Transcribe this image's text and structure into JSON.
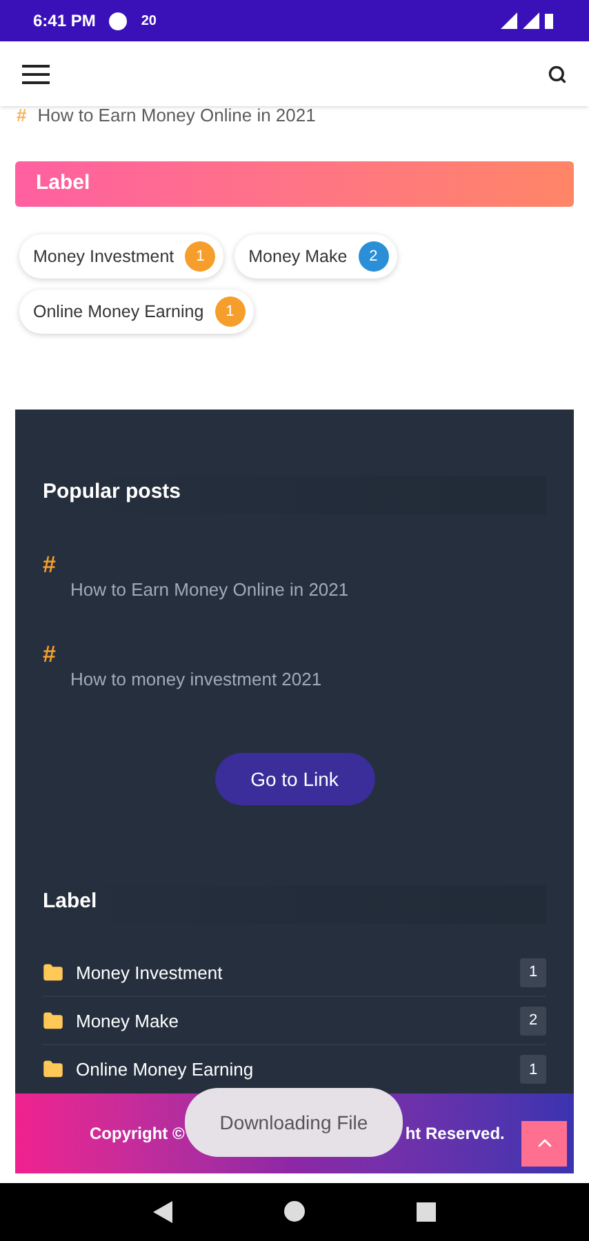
{
  "status_bar": {
    "time": "6:41 PM",
    "speed": "20"
  },
  "top_post": {
    "icon": "#",
    "title": "How to Earn Money Online in 2021"
  },
  "label_header": "Label",
  "label_chips": [
    {
      "name": "Money Investment",
      "count": "1",
      "color": "#f59e2b"
    },
    {
      "name": "Money Make",
      "count": "2",
      "color": "#2a8fd6"
    },
    {
      "name": "Online Money Earning",
      "count": "1",
      "color": "#f59e2b"
    }
  ],
  "popular": {
    "title": "Popular posts",
    "posts": [
      {
        "icon": "#",
        "title": "How to Earn Money Online in 2021"
      },
      {
        "icon": "#",
        "title": "How to money investment 2021"
      }
    ],
    "button": "Go to Link"
  },
  "label_list": {
    "title": "Label",
    "items": [
      {
        "name": "Money Investment",
        "count": "1"
      },
      {
        "name": "Money Make",
        "count": "2"
      },
      {
        "name": "Online Money Earning",
        "count": "1"
      }
    ]
  },
  "footer": {
    "left": "Copyright ©",
    "right": "ht Reserved."
  },
  "toast": "Downloading File"
}
